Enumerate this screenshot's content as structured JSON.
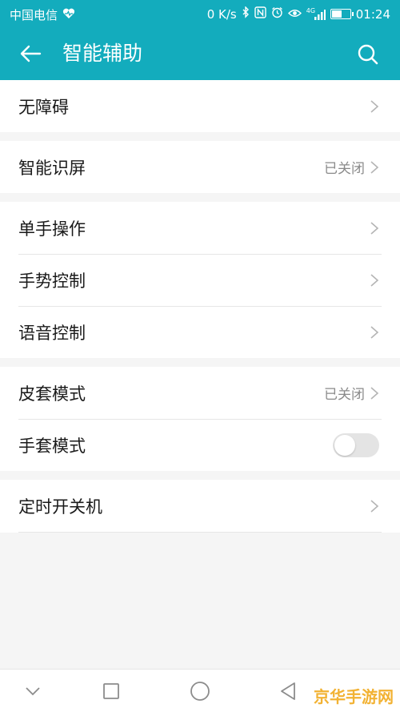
{
  "status_bar": {
    "carrier": "中国电信",
    "network_speed": "0 K/s",
    "signal_label": "4G",
    "battery_level": 0.55,
    "time": "01:24"
  },
  "app_bar": {
    "title": "智能辅助"
  },
  "groups": [
    {
      "items": [
        {
          "label": "无障碍"
        }
      ]
    },
    {
      "items": [
        {
          "label": "智能识屏",
          "status": "已关闭"
        }
      ]
    },
    {
      "items": [
        {
          "label": "单手操作"
        },
        {
          "label": "手势控制"
        },
        {
          "label": "语音控制"
        }
      ]
    },
    {
      "items": [
        {
          "label": "皮套模式",
          "status": "已关闭"
        },
        {
          "label": "手套模式",
          "toggle_on": false
        }
      ]
    },
    {
      "items": [
        {
          "label": "定时开关机"
        }
      ]
    }
  ],
  "colors": {
    "accent": "#13acbd",
    "watermark": "#f2b233"
  },
  "watermark": {
    "text": "京华手游网"
  }
}
